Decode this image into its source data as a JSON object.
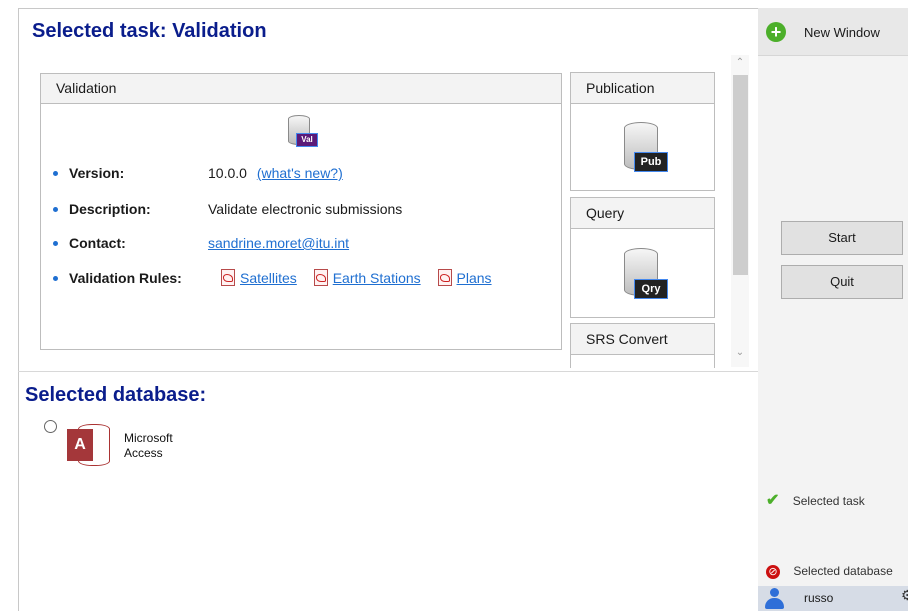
{
  "task_panel": {
    "title": "Selected task: Validation",
    "card_header": "Validation",
    "icon_badge": "Val",
    "version_label": "Version:",
    "version_value": "10.0.0",
    "whats_new": "(what's new?)",
    "description_label": "Description:",
    "description_value": "Validate electronic submissions",
    "contact_label": "Contact:",
    "contact_value": "sandrine.moret@itu.int",
    "rules_label": "Validation Rules:",
    "rules": [
      "Satellites",
      "Earth Stations",
      "Plans"
    ]
  },
  "task_list": [
    {
      "label": "Publication",
      "badge": "Pub"
    },
    {
      "label": "Query",
      "badge": "Qry"
    },
    {
      "label": "SRS Convert"
    }
  ],
  "database_panel": {
    "title": "Selected database:",
    "option_line1": "Microsoft",
    "option_line2": "Access"
  },
  "right_pane": {
    "new_window": "New Window",
    "start": "Start",
    "quit": "Quit",
    "status_task": "Selected task",
    "status_database": "Selected database",
    "user": "russo"
  },
  "colors": {
    "accent": "#0a1d8c",
    "link": "#1f6fd1",
    "badge": "#5b1a78",
    "ok": "#4caf2a",
    "error": "#cc1111"
  }
}
